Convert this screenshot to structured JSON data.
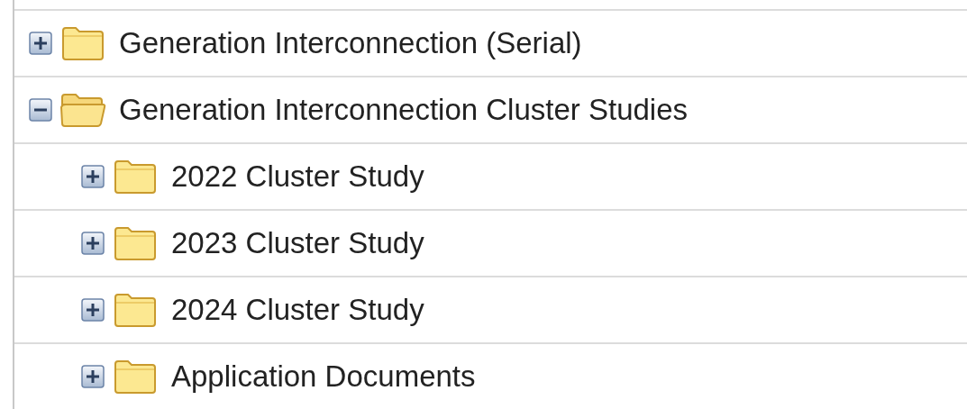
{
  "tree": [
    {
      "label": "Generation Interconnection (Serial)",
      "expanded": false
    },
    {
      "label": "Generation Interconnection Cluster Studies",
      "expanded": true,
      "children": [
        {
          "label": "2022 Cluster Study",
          "expanded": false
        },
        {
          "label": "2023 Cluster Study",
          "expanded": false
        },
        {
          "label": "2024 Cluster Study",
          "expanded": false
        },
        {
          "label": "Application Documents",
          "expanded": false
        }
      ]
    }
  ]
}
